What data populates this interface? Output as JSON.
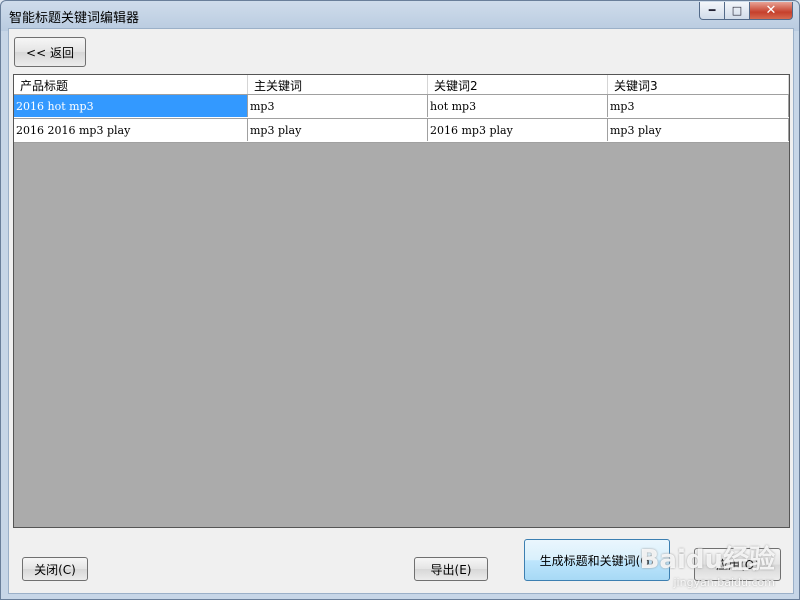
{
  "window": {
    "title": "智能标题关键词编辑器",
    "minimize_icon": "minimize-icon",
    "maximize_icon": "maximize-icon",
    "close_icon": "close-icon"
  },
  "toolbar": {
    "back_label": "<< 返回"
  },
  "grid": {
    "columns": [
      "产品标题",
      "主关键词",
      "关键词2",
      "关键词3"
    ],
    "rows": [
      [
        "2016 hot mp3",
        "mp3",
        "hot mp3",
        "mp3"
      ],
      [
        "2016 2016 mp3 play",
        "mp3 play",
        "2016 mp3 play",
        "mp3 play"
      ]
    ],
    "selected_cell": [
      0,
      0
    ],
    "selection_color": "#3399ff"
  },
  "footer": {
    "close_label": "关闭(C)",
    "export_label": "导出(E)",
    "generate_label": "生成标题和关键词(G)",
    "apply_label": "应用(O)"
  },
  "watermark": {
    "logo": "Baidu经验",
    "url": "jingyan.baidu.com"
  }
}
